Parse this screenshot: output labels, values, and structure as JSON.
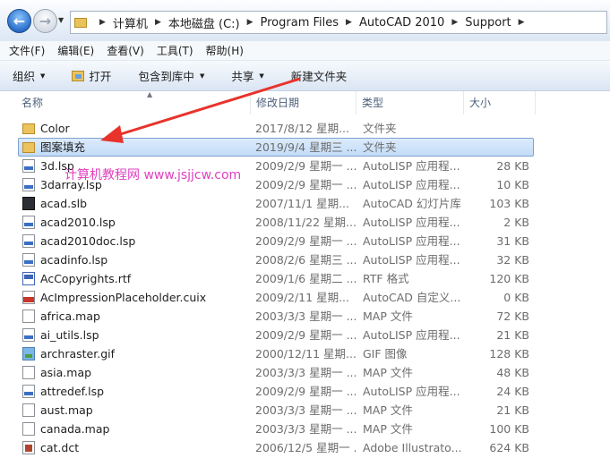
{
  "address": {
    "crumbs": [
      "计算机",
      "本地磁盘 (C:)",
      "Program Files",
      "AutoCAD 2010",
      "Support"
    ]
  },
  "menu": [
    "文件(F)",
    "编辑(E)",
    "查看(V)",
    "工具(T)",
    "帮助(H)"
  ],
  "commands": {
    "organize": "组织",
    "open": "打开",
    "include": "包含到库中",
    "share": "共享",
    "new_folder": "新建文件夹"
  },
  "columns": {
    "name": "名称",
    "date": "修改日期",
    "type": "类型",
    "size": "大小"
  },
  "files": [
    {
      "name": "Color",
      "date": "2017/8/12 星期...",
      "type": "文件夹",
      "size": "",
      "icon": "folder-icon"
    },
    {
      "name": "图案填充",
      "date": "2019/9/4 星期三 ...",
      "type": "文件夹",
      "size": "",
      "icon": "folder-icon",
      "selected": true
    },
    {
      "name": "3d.lsp",
      "date": "2009/2/9 星期一 ...",
      "type": "AutoLISP 应用程...",
      "size": "28 KB",
      "icon": "lsp-file-icon"
    },
    {
      "name": "3darray.lsp",
      "date": "2009/2/9 星期一 ...",
      "type": "AutoLISP 应用程...",
      "size": "10 KB",
      "icon": "lsp-file-icon"
    },
    {
      "name": "acad.slb",
      "date": "2007/11/1 星期...",
      "type": "AutoCAD 幻灯片库",
      "size": "103 KB",
      "icon": "slb-file-icon"
    },
    {
      "name": "acad2010.lsp",
      "date": "2008/11/22 星期...",
      "type": "AutoLISP 应用程...",
      "size": "2 KB",
      "icon": "lsp-file-icon"
    },
    {
      "name": "acad2010doc.lsp",
      "date": "2009/2/9 星期一 ...",
      "type": "AutoLISP 应用程...",
      "size": "31 KB",
      "icon": "lsp-file-icon"
    },
    {
      "name": "acadinfo.lsp",
      "date": "2008/2/6 星期三 ...",
      "type": "AutoLISP 应用程...",
      "size": "32 KB",
      "icon": "lsp-file-icon"
    },
    {
      "name": "AcCopyrights.rtf",
      "date": "2009/1/6 星期二 ...",
      "type": "RTF 格式",
      "size": "120 KB",
      "icon": "rtf-file-icon"
    },
    {
      "name": "AcImpressionPlaceholder.cuix",
      "date": "2009/2/11 星期...",
      "type": "AutoCAD 自定义...",
      "size": "0 KB",
      "icon": "cuix-file-icon"
    },
    {
      "name": "africa.map",
      "date": "2003/3/3 星期一 ...",
      "type": "MAP 文件",
      "size": "72 KB",
      "icon": "map-file-icon"
    },
    {
      "name": "ai_utils.lsp",
      "date": "2009/2/9 星期一 ...",
      "type": "AutoLISP 应用程...",
      "size": "21 KB",
      "icon": "lsp-file-icon"
    },
    {
      "name": "archraster.gif",
      "date": "2000/12/11 星期...",
      "type": "GIF 图像",
      "size": "128 KB",
      "icon": "gif-file-icon"
    },
    {
      "name": "asia.map",
      "date": "2003/3/3 星期一 ...",
      "type": "MAP 文件",
      "size": "48 KB",
      "icon": "map-file-icon"
    },
    {
      "name": "attredef.lsp",
      "date": "2009/2/9 星期一 ...",
      "type": "AutoLISP 应用程...",
      "size": "24 KB",
      "icon": "lsp-file-icon"
    },
    {
      "name": "aust.map",
      "date": "2003/3/3 星期一 ...",
      "type": "MAP 文件",
      "size": "21 KB",
      "icon": "map-file-icon"
    },
    {
      "name": "canada.map",
      "date": "2003/3/3 星期一 ...",
      "type": "MAP 文件",
      "size": "100 KB",
      "icon": "map-file-icon"
    },
    {
      "name": "cat.dct",
      "date": "2006/12/5 星期一 ...",
      "type": "Adobe Illustrato...",
      "size": "624 KB",
      "icon": "dct-file-icon"
    }
  ],
  "watermark": "计算机教程网 www.jsjjcw.com",
  "colors": {
    "annotation_arrow": "#e8332b",
    "selection": "#cce3fb",
    "watermark": "#e040c0"
  }
}
